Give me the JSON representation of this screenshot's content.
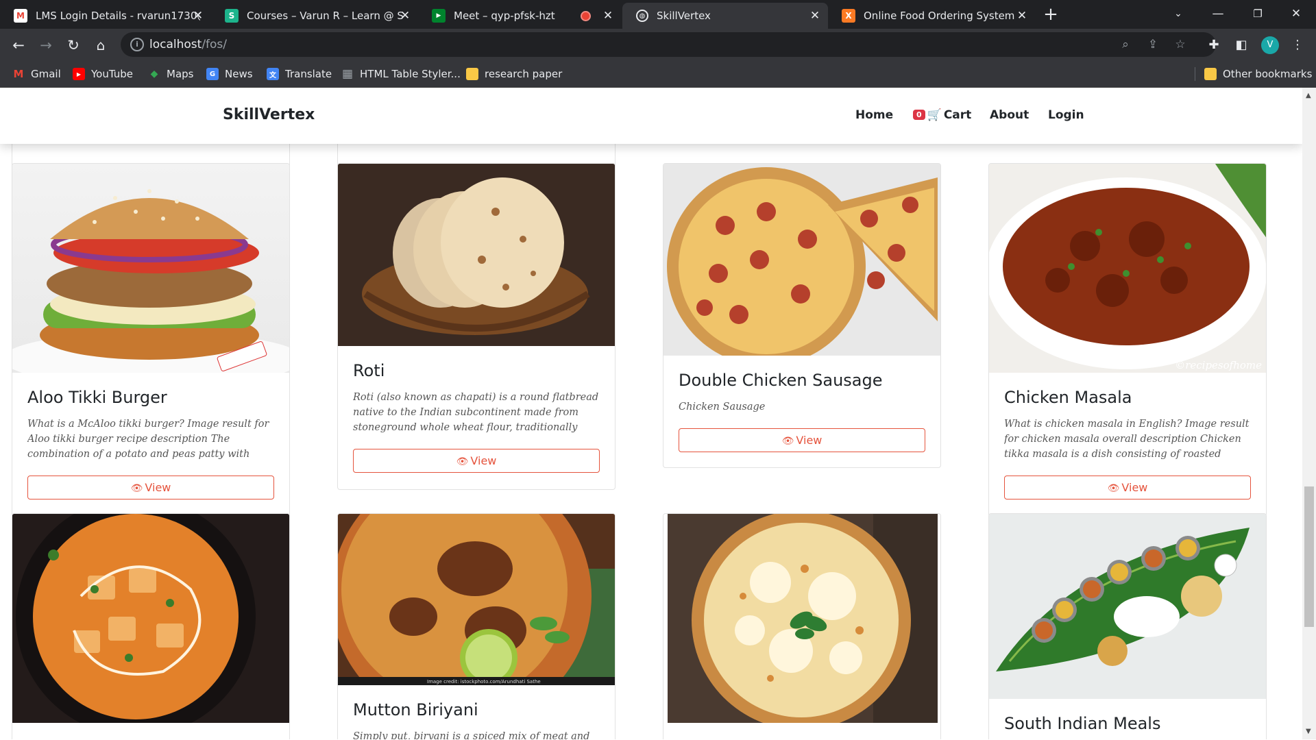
{
  "browser": {
    "tabs": [
      {
        "title": "LMS Login Details - rvarun1730@",
        "icon": "gmail-icon",
        "favicon_color": "#ea4335",
        "favicon_text": "M"
      },
      {
        "title": "Courses – Varun R – Learn @ Skil",
        "icon": "skill-icon",
        "favicon_color": "#1db48c",
        "favicon_text": "S"
      },
      {
        "title": "Meet – qyp-pfsk-hzt",
        "icon": "meet-icon",
        "favicon_color": "#00832d",
        "favicon_text": "▶"
      },
      {
        "title": "SkillVertex",
        "icon": "globe-icon",
        "favicon_color": "#5f6368",
        "favicon_text": "◍"
      },
      {
        "title": "Online Food Ordering System",
        "icon": "xampp-icon",
        "favicon_color": "#fb7a24",
        "favicon_text": "X"
      }
    ],
    "active_tab": 3,
    "url_host": "localhost",
    "url_path": "/fos/",
    "bookmarks": [
      {
        "label": "Gmail",
        "icon": "gmail-icon",
        "color": "#ea4335",
        "glyph": "M"
      },
      {
        "label": "YouTube",
        "icon": "youtube-icon",
        "color": "#ff0000",
        "glyph": "▶"
      },
      {
        "label": "Maps",
        "icon": "maps-icon",
        "color": "#34a853",
        "glyph": "◆"
      },
      {
        "label": "News",
        "icon": "news-icon",
        "color": "#4285f4",
        "glyph": "G"
      },
      {
        "label": "Translate",
        "icon": "translate-icon",
        "color": "#4285f4",
        "glyph": "文"
      },
      {
        "label": "HTML Table Styler...",
        "icon": "grid-icon",
        "color": "#5f6368",
        "glyph": "▦"
      },
      {
        "label": "research paper",
        "icon": "folder-icon",
        "color": "#f9c846",
        "glyph": ""
      }
    ],
    "other_bookmarks": "Other bookmarks",
    "profile_initial": "V"
  },
  "site": {
    "brand": "SkillVertex",
    "nav": {
      "home": "Home",
      "cart_count": "0",
      "cart": "Cart",
      "about": "About",
      "login": "Login"
    },
    "view_label": "View",
    "accent_color": "#e5533c",
    "foods": [
      {
        "name": "Aloo Tikki Burger",
        "desc": "What is a McAloo tikki burger? Image result for Aloo tikki burger recipe description The combination of a potato and peas patty with special Indian spices...",
        "image": "burger-image"
      },
      {
        "name": "Roti",
        "desc": "Roti (also known as chapati) is a round flatbread native to the Indian subcontinent made from stoneground whole wheat flour, traditionally know...",
        "image": "roti-image"
      },
      {
        "name": "Double Chicken Sausage",
        "desc": "Chicken Sausage",
        "image": "sausage-pizza-image"
      },
      {
        "name": "Chicken Masala",
        "desc": "What is chicken masala in English? Image result for chicken masala overall description Chicken tikka masala is a dish consisting of roasted marinated...",
        "image": "chicken-masala-image"
      },
      {
        "name": "",
        "desc": "",
        "image": "paneer-curry-image"
      },
      {
        "name": "Mutton Biriyani",
        "desc": "Simply put, biryani is a spiced mix of meat and rice,",
        "image": "biryani-image"
      },
      {
        "name": "",
        "desc": "",
        "image": "cheese-pizza-image"
      },
      {
        "name": "South Indian Meals",
        "desc": "",
        "image": "south-indian-meals-image"
      }
    ],
    "watermark": "©recipesofhome",
    "image_credit": "Image credit: istockphoto.com/Arundhati Sathe"
  }
}
